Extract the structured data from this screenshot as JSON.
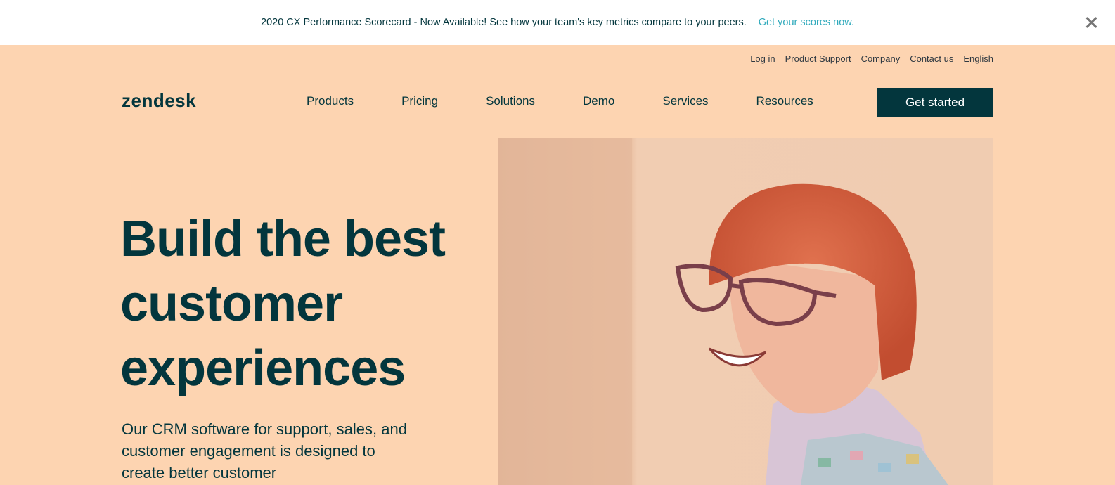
{
  "announcement": {
    "message": "2020 CX Performance Scorecard - Now Available! See how your team's key metrics compare to your peers.",
    "link": "Get your scores now."
  },
  "utility_nav": [
    "Log in",
    "Product Support",
    "Company",
    "Contact us",
    "English"
  ],
  "brand": {
    "logo": "zendesk"
  },
  "main_nav": [
    "Products",
    "Pricing",
    "Solutions",
    "Demo",
    "Services",
    "Resources"
  ],
  "cta": {
    "label": "Get started"
  },
  "hero": {
    "title": "Build the best customer experiences",
    "subtitle": "Our CRM software for support, sales, and customer engagement is designed to create better customer"
  },
  "colors": {
    "background": "#fdd4b1",
    "brand_dark": "#03363d",
    "link_accent": "#30aabc"
  }
}
